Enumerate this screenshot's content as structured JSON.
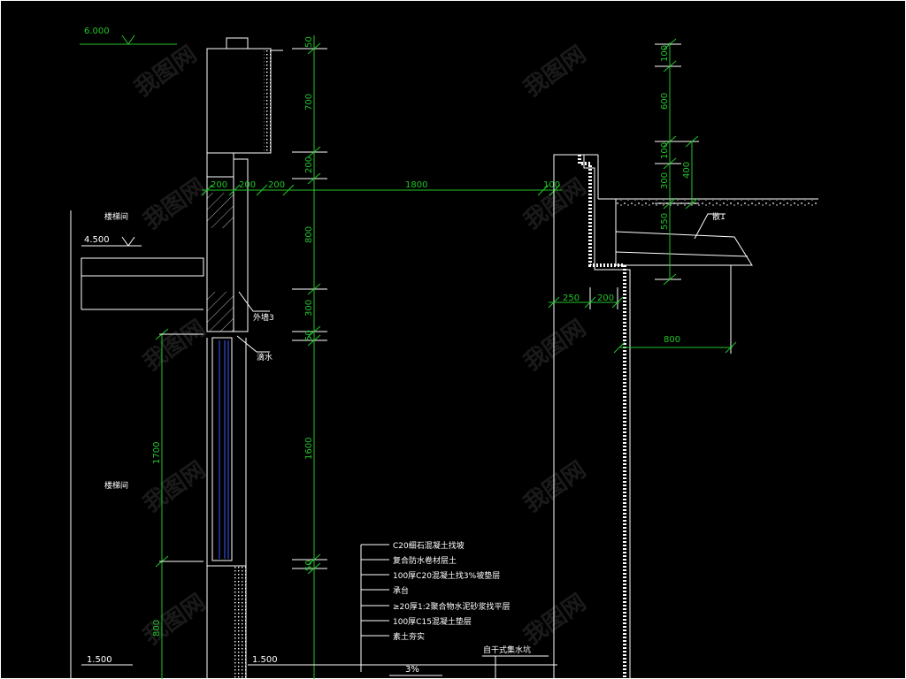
{
  "elevations": {
    "top": "6.000",
    "floor": "4.500",
    "ground_left": "1.500",
    "ground_mid": "1.500"
  },
  "room_labels": {
    "upper": "楼梯间",
    "lower": "楼梯间"
  },
  "dims_vertical_mid": [
    "50",
    "700",
    "200",
    "800",
    "300",
    "50",
    "1600",
    "50"
  ],
  "dims_horizontal_mid": [
    "200",
    "200",
    "200",
    "1800",
    "100"
  ],
  "dims_left": [
    "1700",
    "800"
  ],
  "dims_right_vertical": [
    "100",
    "600",
    "100",
    "300",
    "400",
    "550"
  ],
  "dims_right_horizontal": [
    "250",
    "200",
    "800"
  ],
  "callouts": {
    "wall": "外墙3",
    "drip": "滴水",
    "right": "散1",
    "pit": "自干式集水坑"
  },
  "slope": "3%",
  "layer_notes": [
    "C20细石混凝土找坡",
    "复合防水卷材层土",
    "100厚C20混凝土找3%坡垫层",
    "承台",
    "≥20厚1:2聚合物水泥砂浆找平层",
    "100厚C15混凝土垫层",
    "素土夯实"
  ],
  "watermark": "我图网",
  "colors": {
    "background": "#000000",
    "linework": "#ffffff",
    "dimension": "#22c52a",
    "glass": "#3b5bff"
  }
}
